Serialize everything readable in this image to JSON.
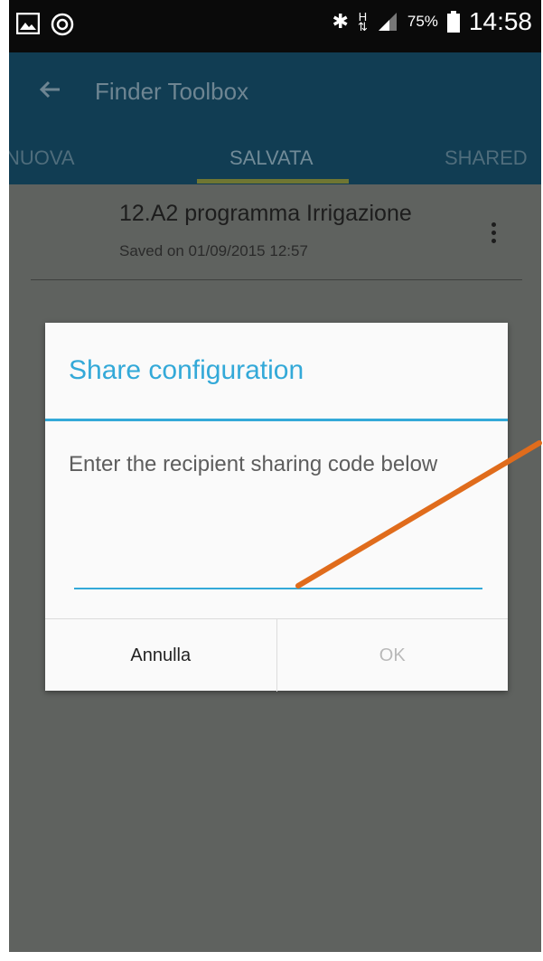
{
  "status_bar": {
    "icons_left": [
      "image-icon",
      "at-notification-icon"
    ],
    "icons_right": [
      "bluetooth-icon",
      "hplus-icon",
      "signal-icon",
      "battery-icon"
    ],
    "battery": "75%",
    "time": "14:58"
  },
  "app_bar": {
    "title": "Finder Toolbox"
  },
  "tabs": [
    {
      "label": "NUOVA",
      "active": false
    },
    {
      "label": "SALVATA",
      "active": true
    },
    {
      "label": "SHARED",
      "active": false
    }
  ],
  "saved_item": {
    "title": "12.A2  programma Irrigazione",
    "subtitle": "Saved on 01/09/2015 12:57"
  },
  "dialog": {
    "title": "Share configuration",
    "message": "Enter the recipient sharing code below",
    "input_value": "",
    "cancel_label": "Annulla",
    "ok_label": "OK"
  },
  "colors": {
    "accent": "#33a9d8",
    "app_bar": "#113d53",
    "annotation_arrow": "#e06c1c"
  }
}
